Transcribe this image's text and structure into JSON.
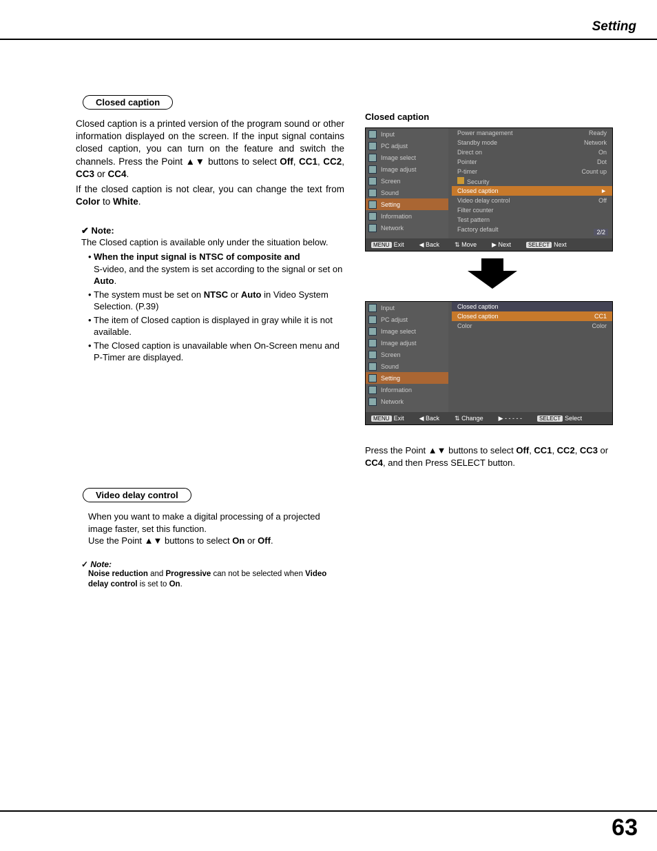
{
  "header": {
    "section": "Setting"
  },
  "pills": {
    "closed_caption": "Closed caption",
    "video_delay": "Video delay control"
  },
  "cc": {
    "para1_a": "Closed caption is a printed version of the program sound or other information displayed on the screen. If the input signal contains closed caption, you can turn on the feature and switch the channels. Press the Point ▲▼ buttons to select ",
    "opt_off": "Off",
    "c": ", ",
    "opt_cc1": "CC1",
    "opt_cc2": "CC2",
    "opt_cc3": "CC3",
    "or": " or ",
    "opt_cc4": "CC4",
    "dot": ".",
    "para2_a": "If the closed caption is not clear, you can change the text from ",
    "color": "Color",
    "to": " to ",
    "white": "White",
    "note_label": "Note:",
    "note_intro": "The Closed caption is available only under the situation below.",
    "b1_a": "When the input signal is NTSC of composite and",
    "b1_b": "S-video, and the system is set according to the signal or set on ",
    "auto": "Auto",
    "b2_a": "The system must be set on ",
    "ntsc": "NTSC",
    "b2_b": " in Video System Selection. (P.39)",
    "b3": "The item of Closed caption is displayed in gray while it is not available.",
    "b4": "The Closed caption is unavailable when On-Screen menu and P-Timer are displayed."
  },
  "vd": {
    "body1": "When you want to make a digital processing of a projected image faster, set this function.",
    "body2_a": "Use the Point ▲▼ buttons to select ",
    "on": "On",
    "or": " or ",
    "off": "Off",
    "dot": ".",
    "note_label": "Note:",
    "note_a": "Noise reduction",
    "note_b": " and ",
    "note_c": "Progressive",
    "note_d": " can not be selected when ",
    "note_e": "Video delay control",
    "note_f": " is set to ",
    "note_g": "On",
    "note_h": "."
  },
  "right": {
    "fig_title": "Closed caption",
    "caption_a": "Press the Point ▲▼ buttons to select ",
    "off": "Off",
    "c": ", ",
    "cc1": "CC1",
    "cc2": "CC2",
    "cc3": "CC3",
    "or": " or ",
    "cc4": "CC4",
    "caption_b": ", and then Press SELECT button."
  },
  "osd1": {
    "side": [
      "Input",
      "PC adjust",
      "Image select",
      "Image adjust",
      "Screen",
      "Sound",
      "Setting",
      "Information",
      "Network"
    ],
    "side_sel": 6,
    "rows": [
      {
        "l": "Power management",
        "r": "Ready"
      },
      {
        "l": "Standby mode",
        "r": "Network"
      },
      {
        "l": "Direct on",
        "r": "On"
      },
      {
        "l": "Pointer",
        "r": "Dot"
      },
      {
        "l": "P-timer",
        "r": "Count up"
      },
      {
        "l": "Security",
        "r": "",
        "lock": true
      },
      {
        "l": "Closed caption",
        "r": "►",
        "hl": true
      },
      {
        "l": "Video delay control",
        "r": "Off"
      },
      {
        "l": "Filter counter",
        "r": ""
      },
      {
        "l": "Test pattern",
        "r": ""
      },
      {
        "l": "Factory default",
        "r": ""
      }
    ],
    "page": "2/2",
    "bar": {
      "exit": "Exit",
      "back": "◀ Back",
      "move": "Move",
      "next": "▶ Next",
      "sel": "Next",
      "menu": "MENU",
      "updown": "⇅",
      "select": "SELECT"
    }
  },
  "osd2": {
    "side": [
      "Input",
      "PC adjust",
      "Image select",
      "Image adjust",
      "Screen",
      "Sound",
      "Setting",
      "Information",
      "Network"
    ],
    "side_sel": 6,
    "title": "Closed caption",
    "rows": [
      {
        "l": "Closed caption",
        "r": "CC1",
        "hl": true
      },
      {
        "l": "Color",
        "r": "Color"
      }
    ],
    "bar": {
      "exit": "Exit",
      "back": "◀ Back",
      "change": "Change",
      "dash": "▶ - - - - -",
      "sel": "Select",
      "menu": "MENU",
      "updown": "⇅",
      "select": "SELECT"
    }
  },
  "footer": {
    "page": "63"
  }
}
